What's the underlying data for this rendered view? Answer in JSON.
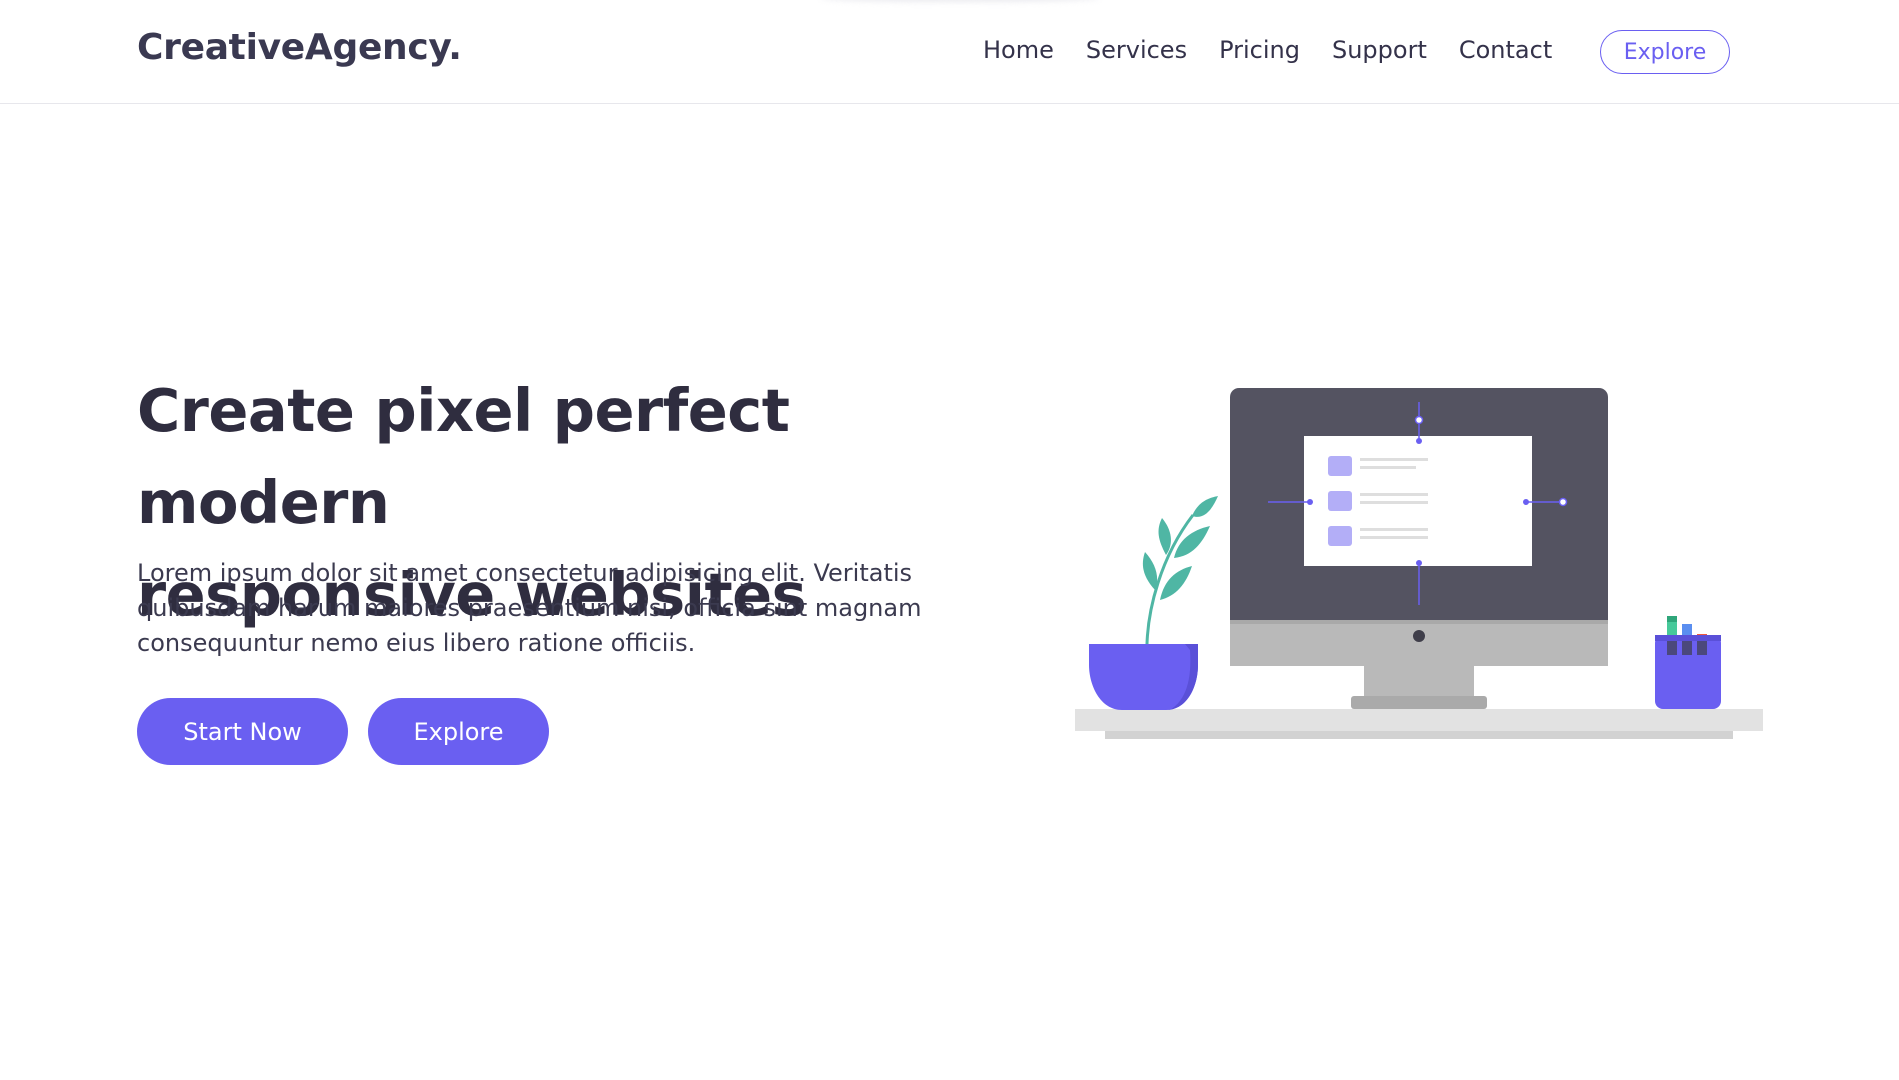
{
  "brand": {
    "name": "CreativeAgency."
  },
  "nav": {
    "items": [
      {
        "label": "Home"
      },
      {
        "label": "Services"
      },
      {
        "label": "Pricing"
      },
      {
        "label": "Support"
      },
      {
        "label": "Contact"
      }
    ],
    "cta_label": "Explore"
  },
  "hero": {
    "title_line1": "Create pixel perfect modern",
    "title_line2": "responsive websites",
    "description": "Lorem ipsum dolor sit amet consectetur adipisicing elit. Veritatis quibusdam harum maiores praesentium nisi, officia sint magnam consequuntur nemo eius libero ratione officiis.",
    "primary_label": "Start Now",
    "secondary_label": "Explore"
  },
  "colors": {
    "accent": "#6a5ff1",
    "text_dark": "#2f2d3f",
    "monitor": "#545361",
    "plant_leaf": "#4fb6a4"
  },
  "illustration": {
    "icons": [
      "desktop-monitor-icon",
      "plant-pot-icon",
      "pen-holder-icon"
    ]
  }
}
